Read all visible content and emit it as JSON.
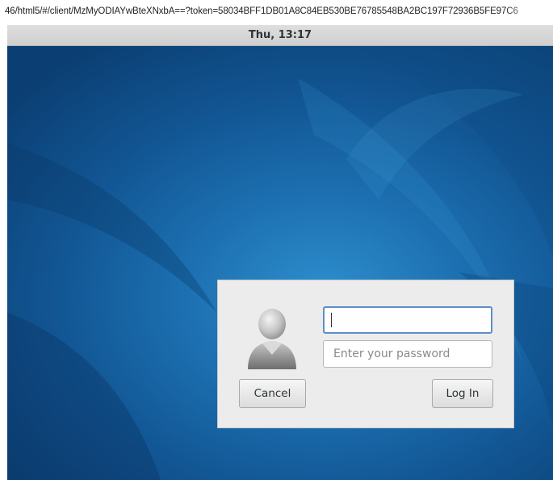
{
  "browser": {
    "url": "46/html5/#/client/MzMyODIAYwBteXNxbA==?token=58034BFF1DB01A8C84EB530BE76785548BA2BC197F72936B5FE97C6"
  },
  "top_bar": {
    "clock": "Thu, 13:17"
  },
  "login_dialog": {
    "avatar_icon": "user-avatar-icon",
    "username_value": "",
    "password_placeholder": "Enter your password",
    "cancel_label": "Cancel",
    "login_label": "Log In"
  },
  "colors": {
    "desktop_accent": "#1c6fb0",
    "focus_border": "#5d8ec6",
    "dialog_bg": "#ececec"
  }
}
